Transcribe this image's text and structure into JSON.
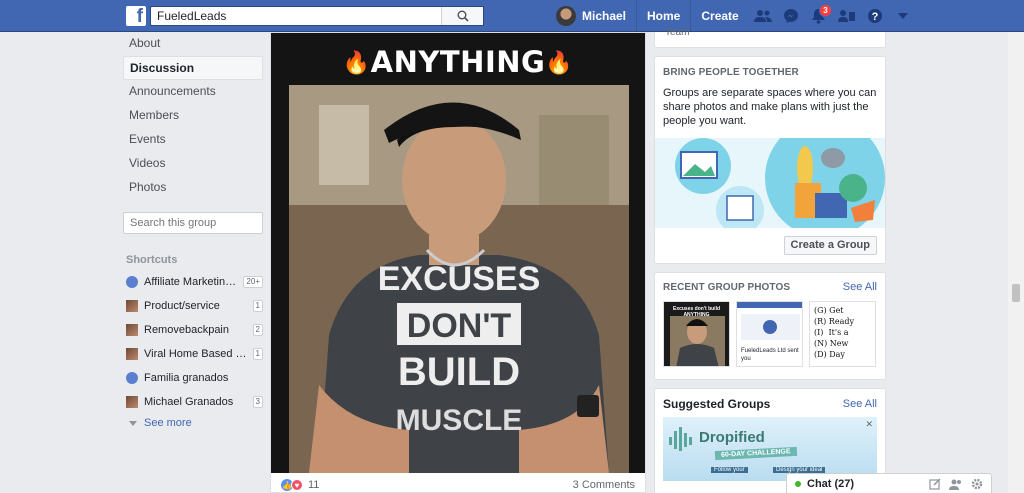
{
  "topbar": {
    "search_value": "FueledLeads",
    "user_name": "Michael",
    "home_label": "Home",
    "create_label": "Create",
    "notifications_count": "3",
    "brand_color": "#4267b2"
  },
  "left_menu": {
    "items": [
      "About",
      "Discussion",
      "Announcements",
      "Members",
      "Events",
      "Videos",
      "Photos"
    ],
    "active": "Discussion",
    "search_placeholder": "Search this group"
  },
  "shortcuts": {
    "heading": "Shortcuts",
    "items": [
      {
        "label": "Affiliate Marketing -...",
        "count": "20+",
        "icon": "group-icon"
      },
      {
        "label": "Product/service",
        "count": "1",
        "icon": "photo-icon"
      },
      {
        "label": "Removebackpain",
        "count": "2",
        "icon": "photo-icon"
      },
      {
        "label": "Viral Home Based P...",
        "count": "1",
        "icon": "photo-icon"
      },
      {
        "label": "Familia granados",
        "count": "",
        "icon": "group-icon"
      },
      {
        "label": "Michael Granados",
        "count": "3",
        "icon": "photo-icon"
      }
    ],
    "see_more": "See more"
  },
  "post": {
    "headline": "ANYTHING",
    "shirt_lines": [
      "EXCUSES",
      "DON'T",
      "BUILD",
      "MUSCLE"
    ],
    "reactions_count": "11",
    "comments": "3 Comments"
  },
  "right": {
    "stub_text": "Team",
    "bring_title": "BRING PEOPLE TOGETHER",
    "bring_body": "Groups are separate spaces where you can share photos and make plans with just the people you want.",
    "create_group": "Create a Group",
    "recent_photos_title": "RECENT GROUP PHOTOS",
    "see_all": "See All",
    "thumb1_text": "Excuses don't build ANYTHING",
    "thumb2_text": "FueledLeads Ltd sent you",
    "thumb3_text": "(G) Get\n(R) Ready\n(I)  It's a\n(N) New\n(D) Day",
    "suggested_title": "Suggested Groups",
    "sugg_logo": "Dropified",
    "sugg_sub": "60-DAY CHALLENGE",
    "sugg_line1": "Follow your",
    "sugg_line2": "Design your ideal"
  },
  "chat": {
    "label": "Chat (27)"
  }
}
